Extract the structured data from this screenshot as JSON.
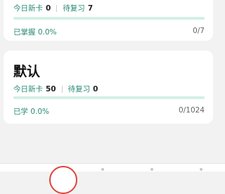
{
  "decks": [
    {
      "title": "",
      "new_today_label": "今日新卡",
      "new_today_value": "0",
      "to_review_label": "待复习",
      "to_review_value": "7",
      "progress_label": "已掌握 0.0%",
      "progress_fraction": 0.0,
      "count": "0/7"
    },
    {
      "title": "默认",
      "new_today_label": "今日新卡",
      "new_today_value": "50",
      "to_review_label": "待复习",
      "to_review_value": "0",
      "progress_label": "已学 0.0%",
      "progress_fraction": 0.0,
      "count": "0/1024"
    }
  ],
  "colors": {
    "accent": "#2fb38f",
    "accent_light": "#d5efe6",
    "center_tab_ring": "#e0443a"
  }
}
